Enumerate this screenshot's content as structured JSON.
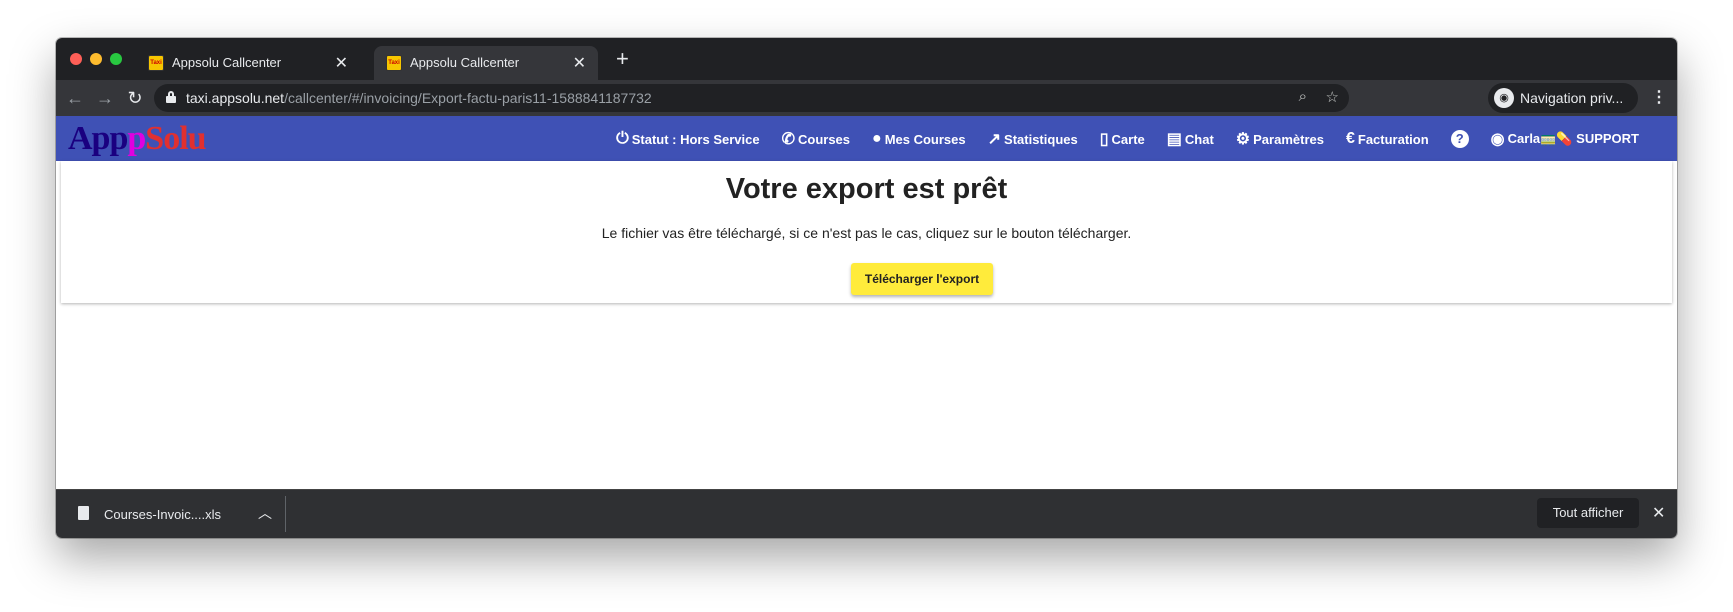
{
  "browser": {
    "tabs": [
      {
        "title": "Appsolu Callcenter",
        "active": false,
        "favicon": "Taxi"
      },
      {
        "title": "Appsolu Callcenter",
        "active": true,
        "favicon": "Taxi"
      }
    ],
    "url_host": "taxi.appsolu.net",
    "url_path": "/callcenter/#/invoicing/Export-factu-paris11-1588841187732",
    "profile_label": "Navigation priv..."
  },
  "app": {
    "logo": {
      "part1": "App",
      "part2": "p",
      "part3": "Solu"
    },
    "nav": {
      "status": "Statut : Hors Service",
      "courses": "Courses",
      "mes_courses": "Mes Courses",
      "statistiques": "Statistiques",
      "carte": "Carte",
      "chat": "Chat",
      "parametres": "Paramètres",
      "facturation": "Facturation",
      "help": "?",
      "user": "Carla🚃💊 SUPPORT"
    },
    "colors": {
      "appbar": "#3f51b5",
      "button": "#ffeb3b"
    }
  },
  "page": {
    "title": "Votre export est prêt",
    "message": "Le fichier vas être téléchargé, si ce n'est pas le cas, cliquez sur le bouton télécharger.",
    "download_button": "Télécharger l'export"
  },
  "downloads": {
    "file_name": "Courses-Invoic....xls",
    "show_all": "Tout afficher"
  }
}
